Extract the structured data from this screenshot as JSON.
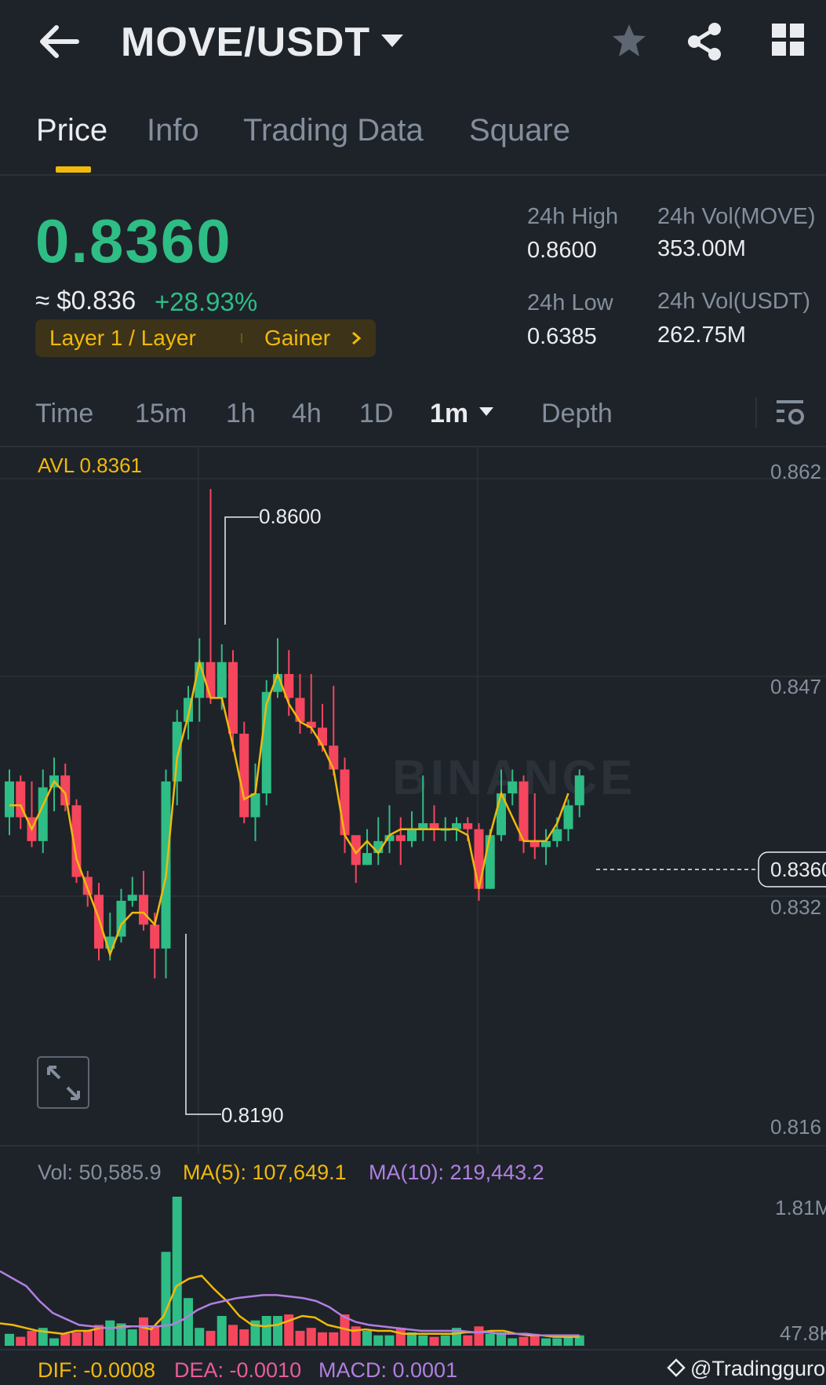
{
  "header": {
    "pair": "MOVE/USDT",
    "icons": [
      "back-arrow-icon",
      "dropdown-caret-icon",
      "star-icon",
      "share-icon",
      "grid-icon"
    ]
  },
  "tabs": [
    "Price",
    "Info",
    "Trading Data",
    "Square"
  ],
  "ticker": {
    "last_price": "0.8360",
    "usd_price": "≈ $0.836",
    "change_pct": "+28.93%",
    "tag_category": "Layer 1 / Layer",
    "tag_gainer": "Gainer",
    "stats": {
      "high_label": "24h High",
      "high_value": "0.8600",
      "vol_base_label": "24h Vol(MOVE)",
      "vol_base_value": "353.00M",
      "low_label": "24h Low",
      "low_value": "0.6385",
      "vol_quote_label": "24h Vol(USDT)",
      "vol_quote_value": "262.75M"
    }
  },
  "intervals": [
    "Time",
    "15m",
    "1h",
    "4h",
    "1D",
    "1m",
    "Depth"
  ],
  "chart_labels": {
    "avl": "AVL 0.8361",
    "price_axis": [
      "0.862",
      "0.847",
      "0.8360",
      "0.832",
      "0.816"
    ],
    "max_marker": "0.8600",
    "min_marker": "0.8190",
    "watermark": "BINANCE",
    "vol_label": "Vol: 50,585.9",
    "vol_ma5": "MA(5): 107,649.1",
    "vol_ma10": "MA(10): 219,443.2",
    "vol_axis": [
      "1.81M",
      "47.8K"
    ],
    "dif": "DIF: -0.0008",
    "dea": "DEA: -0.0010",
    "macd": "MACD: 0.0001",
    "credit": "@Tradingguro"
  },
  "colors": {
    "up": "#2ebd85",
    "down": "#f6465d",
    "accent": "#f0b90b",
    "ma10": "#b17fe0",
    "bg": "#1e2329"
  },
  "chart_data": {
    "type": "candlestick",
    "price_range": [
      0.8155,
      0.8635
    ],
    "last_price": 0.836,
    "max": 0.86,
    "min": 0.819,
    "candles": [
      [
        0.8325,
        0.8355,
        0.8365,
        0.831
      ],
      [
        0.8355,
        0.8325,
        0.836,
        0.8315
      ],
      [
        0.8325,
        0.8305,
        0.8355,
        0.83
      ],
      [
        0.8305,
        0.835,
        0.8365,
        0.8295
      ],
      [
        0.835,
        0.836,
        0.8375,
        0.833
      ],
      [
        0.836,
        0.8335,
        0.837,
        0.833
      ],
      [
        0.8335,
        0.8275,
        0.834,
        0.827
      ],
      [
        0.8275,
        0.826,
        0.828,
        0.825
      ],
      [
        0.826,
        0.8215,
        0.827,
        0.8205
      ],
      [
        0.8215,
        0.8225,
        0.8245,
        0.8205
      ],
      [
        0.8225,
        0.8255,
        0.8265,
        0.822
      ],
      [
        0.8255,
        0.826,
        0.8275,
        0.825
      ],
      [
        0.826,
        0.8235,
        0.828,
        0.823
      ],
      [
        0.8235,
        0.8215,
        0.8245,
        0.819
      ],
      [
        0.8215,
        0.8355,
        0.8365,
        0.819
      ],
      [
        0.8355,
        0.8405,
        0.8415,
        0.8335
      ],
      [
        0.8405,
        0.8425,
        0.8435,
        0.839
      ],
      [
        0.8425,
        0.8455,
        0.8475,
        0.8405
      ],
      [
        0.8455,
        0.8425,
        0.86,
        0.842
      ],
      [
        0.8425,
        0.8455,
        0.847,
        0.8415
      ],
      [
        0.8455,
        0.8395,
        0.8465,
        0.838
      ],
      [
        0.8395,
        0.8325,
        0.8405,
        0.832
      ],
      [
        0.8325,
        0.8345,
        0.837,
        0.8305
      ],
      [
        0.8345,
        0.843,
        0.844,
        0.8335
      ],
      [
        0.843,
        0.8445,
        0.8475,
        0.8425
      ],
      [
        0.8445,
        0.8425,
        0.8465,
        0.841
      ],
      [
        0.8425,
        0.8405,
        0.8445,
        0.8395
      ],
      [
        0.8405,
        0.84,
        0.8445,
        0.8395
      ],
      [
        0.84,
        0.8385,
        0.842,
        0.838
      ],
      [
        0.8385,
        0.8365,
        0.8435,
        0.836
      ],
      [
        0.8365,
        0.831,
        0.8375,
        0.8295
      ],
      [
        0.831,
        0.8285,
        0.8305,
        0.827
      ],
      [
        0.8285,
        0.8295,
        0.8315,
        0.8285
      ],
      [
        0.8295,
        0.8305,
        0.8325,
        0.8285
      ],
      [
        0.8305,
        0.831,
        0.8335,
        0.8295
      ],
      [
        0.831,
        0.8305,
        0.8325,
        0.8285
      ],
      [
        0.8305,
        0.8315,
        0.833,
        0.83
      ],
      [
        0.8315,
        0.832,
        0.836,
        0.8305
      ],
      [
        0.832,
        0.8315,
        0.8335,
        0.8305
      ],
      [
        0.8315,
        0.8315,
        0.8325,
        0.8305
      ],
      [
        0.8315,
        0.832,
        0.8325,
        0.8305
      ],
      [
        0.832,
        0.8315,
        0.8325,
        0.8305
      ],
      [
        0.8315,
        0.8265,
        0.832,
        0.8255
      ],
      [
        0.8265,
        0.831,
        0.8315,
        0.8265
      ],
      [
        0.831,
        0.8345,
        0.8365,
        0.8305
      ],
      [
        0.8345,
        0.8355,
        0.8365,
        0.8335
      ],
      [
        0.8355,
        0.8305,
        0.836,
        0.8295
      ],
      [
        0.8305,
        0.83,
        0.8345,
        0.829
      ],
      [
        0.83,
        0.8305,
        0.8315,
        0.8285
      ],
      [
        0.8305,
        0.8315,
        0.8325,
        0.83
      ],
      [
        0.8315,
        0.8335,
        0.834,
        0.8305
      ],
      [
        0.8335,
        0.836,
        0.8365,
        0.8325
      ]
    ],
    "ma_line": [
      0.8335,
      0.8335,
      0.8315,
      0.8335,
      0.8355,
      0.8345,
      0.829,
      0.8265,
      0.824,
      0.821,
      0.8235,
      0.8245,
      0.8245,
      0.8235,
      0.8275,
      0.8375,
      0.841,
      0.8455,
      0.8425,
      0.8425,
      0.8385,
      0.834,
      0.8345,
      0.842,
      0.8445,
      0.842,
      0.8405,
      0.84,
      0.8385,
      0.8365,
      0.831,
      0.8295,
      0.8305,
      0.8295,
      0.831,
      0.8315,
      0.8315,
      0.8315,
      0.8315,
      0.8315,
      0.8315,
      0.831,
      0.8265,
      0.831,
      0.8345,
      0.8325,
      0.8305,
      0.8305,
      0.8305,
      0.832,
      0.8345
    ],
    "volume_axis_max": 1810000,
    "volumes": [
      0.08,
      0.06,
      0.1,
      0.12,
      0.05,
      0.08,
      0.09,
      0.1,
      0.14,
      0.17,
      0.15,
      0.11,
      0.19,
      0.13,
      0.63,
      1.0,
      0.32,
      0.12,
      0.1,
      0.2,
      0.14,
      0.11,
      0.17,
      0.2,
      0.2,
      0.21,
      0.1,
      0.12,
      0.09,
      0.09,
      0.21,
      0.13,
      0.1,
      0.07,
      0.07,
      0.12,
      0.09,
      0.07,
      0.06,
      0.07,
      0.12,
      0.07,
      0.13,
      0.08,
      0.09,
      0.05,
      0.06,
      0.08,
      0.05,
      0.05,
      0.06,
      0.07
    ],
    "vol_ma5": [
      0.15,
      0.14,
      0.12,
      0.1,
      0.09,
      0.08,
      0.1,
      0.1,
      0.12,
      0.12,
      0.13,
      0.13,
      0.11,
      0.2,
      0.4,
      0.45,
      0.47,
      0.38,
      0.3,
      0.2,
      0.14,
      0.13,
      0.14,
      0.17,
      0.2,
      0.19,
      0.14,
      0.12,
      0.1,
      0.11,
      0.1,
      0.1,
      0.08,
      0.08,
      0.08,
      0.08,
      0.08,
      0.09,
      0.09,
      0.1,
      0.1,
      0.08,
      0.07,
      0.07,
      0.06,
      0.06,
      0.06
    ],
    "vol_ma10": [
      0.5,
      0.45,
      0.4,
      0.3,
      0.22,
      0.18,
      0.14,
      0.13,
      0.12,
      0.12,
      0.13,
      0.13,
      0.13,
      0.14,
      0.18,
      0.24,
      0.28,
      0.3,
      0.32,
      0.33,
      0.34,
      0.34,
      0.33,
      0.32,
      0.3,
      0.26,
      0.2,
      0.16,
      0.14,
      0.13,
      0.12,
      0.11,
      0.1,
      0.1,
      0.1,
      0.1,
      0.09,
      0.09,
      0.08,
      0.08,
      0.08,
      0.07,
      0.07,
      0.07,
      0.07
    ]
  }
}
